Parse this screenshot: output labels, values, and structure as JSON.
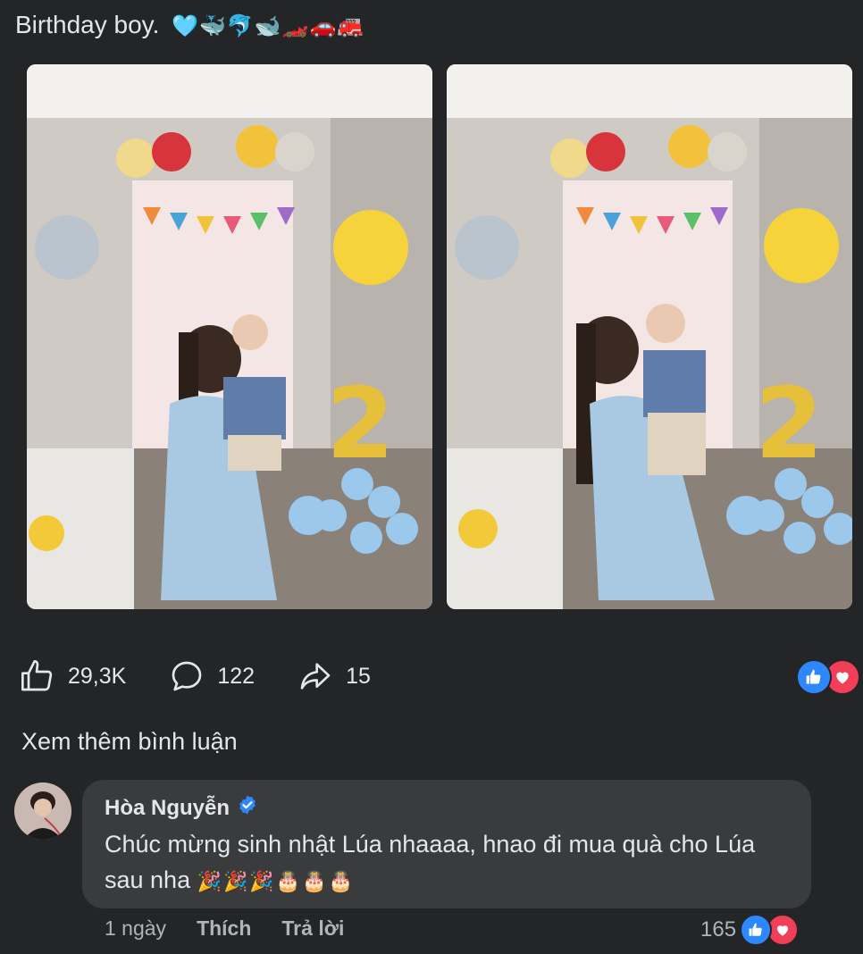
{
  "post": {
    "caption": "Birthday boy.",
    "caption_emojis": "🩵🐳🐬🐋🏎️🚗🚒"
  },
  "stats": {
    "likes": "29,3K",
    "comments": "122",
    "shares": "15"
  },
  "reactions": [
    "like",
    "love"
  ],
  "view_more_comments": "Xem thêm bình luận",
  "comment": {
    "author": "Hòa Nguyễn",
    "verified": true,
    "text": "Chúc mừng sinh nhật Lúa nhaaaa, hnao đi mua quà cho Lúa sau nha",
    "text_emojis": "🎉🎉🎉🎂🎂🎂",
    "time": "1 ngày",
    "like_label": "Thích",
    "reply_label": "Trả lời",
    "reaction_count": "165"
  },
  "colors": {
    "background": "#242526",
    "bubble": "#3a3b3c",
    "like_blue": "#2d88ff",
    "love_red": "#f33e58",
    "secondary_text": "#b0b3b8"
  }
}
